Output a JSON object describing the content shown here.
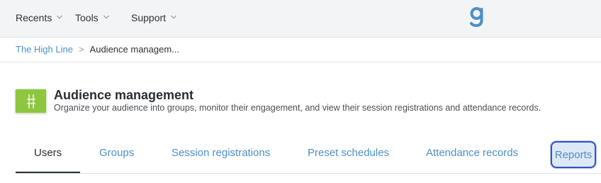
{
  "topnav": {
    "menus": [
      {
        "label": "Recents"
      },
      {
        "label": "Tools"
      },
      {
        "label": "Support"
      }
    ],
    "logo_icon": "g-logo-icon",
    "accent_color": "#4d90c6"
  },
  "breadcrumb": {
    "parent": "The High Line",
    "separator": ">",
    "current": "Audience managem..."
  },
  "header": {
    "title": "Audience management",
    "subtitle": "Organize your audience into groups, monitor their engagement,  and view their session registrations and attendance records.",
    "app_icon": "app-icon",
    "app_icon_color": "#8dc63f"
  },
  "tabs": [
    {
      "label": "Users",
      "active": true
    },
    {
      "label": "Groups",
      "active": false
    },
    {
      "label": "Session registrations",
      "active": false
    },
    {
      "label": "Preset schedules",
      "active": false
    },
    {
      "label": "Attendance records",
      "active": false
    },
    {
      "label": "Reports",
      "active": false
    }
  ]
}
